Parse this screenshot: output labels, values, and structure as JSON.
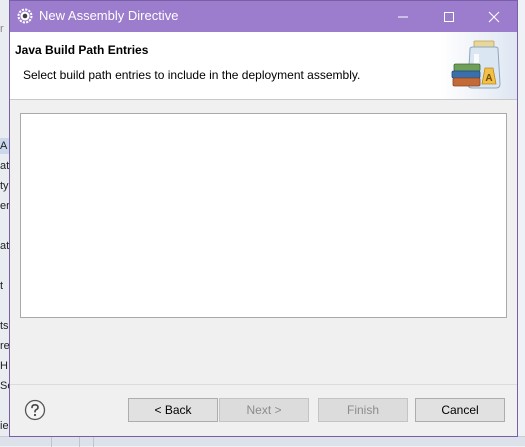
{
  "window": {
    "title": "New Assembly Directive"
  },
  "header": {
    "title": "Java Build Path Entries",
    "description": "Select build path entries to include in the deployment assembly."
  },
  "entries": [],
  "buttons": {
    "back": "< Back",
    "next": "Next >",
    "finish": "Finish",
    "cancel": "Cancel"
  },
  "background_fragments": [
    "r",
    "A",
    "at",
    "ty",
    "er",
    "at",
    "t",
    "ts",
    "re",
    "H",
    "Se",
    "ie"
  ],
  "colors": {
    "titlebar": "#9b7ccd",
    "dialog_border": "#7a5fa8"
  }
}
